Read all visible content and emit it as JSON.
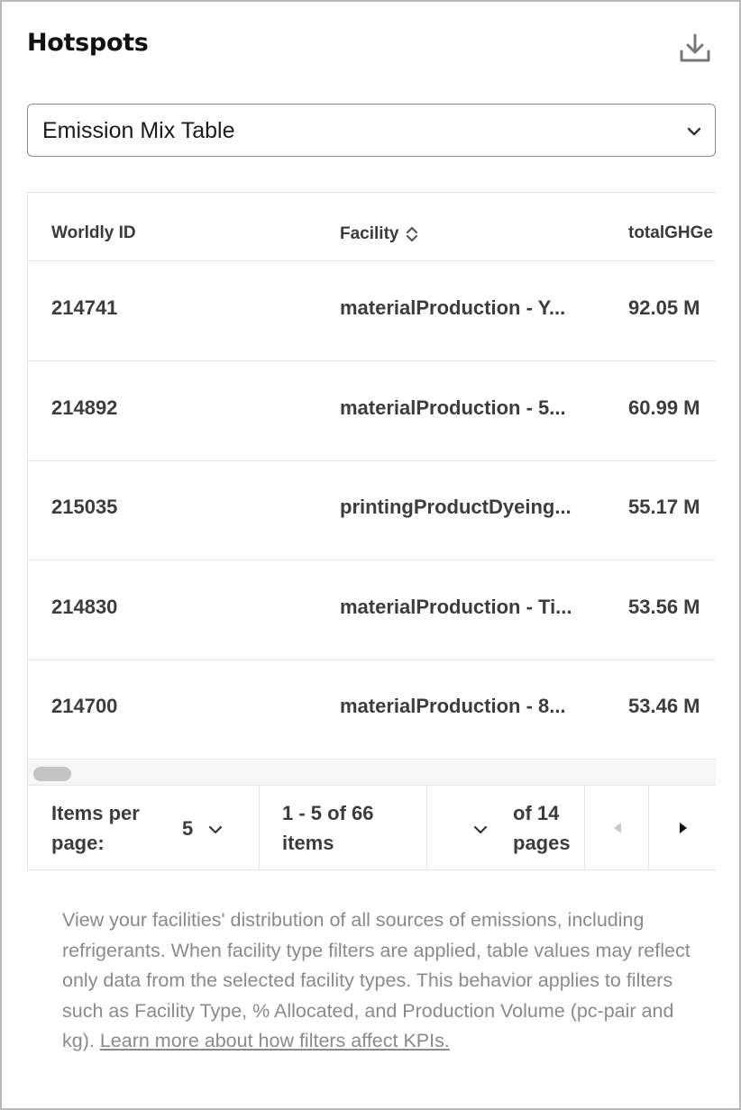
{
  "header": {
    "title": "Hotspots",
    "download_icon": "download-icon"
  },
  "view_select": {
    "selected": "Emission Mix Table"
  },
  "table": {
    "columns": [
      "Worldly ID",
      "Facility",
      "totalGHGe"
    ],
    "rows": [
      {
        "id": "214741",
        "facility": "materialProduction - Y...",
        "total": "92.05 M"
      },
      {
        "id": "214892",
        "facility": "materialProduction - 5...",
        "total": "60.99 M"
      },
      {
        "id": "215035",
        "facility": "printingProductDyeing...",
        "total": "55.17 M"
      },
      {
        "id": "214830",
        "facility": "materialProduction - Ti...",
        "total": "53.56 M"
      },
      {
        "id": "214700",
        "facility": "materialProduction - 8...",
        "total": "53.46 M"
      }
    ]
  },
  "pagination": {
    "items_per_page_label": "Items per page:",
    "items_per_page_value": "5",
    "range_text": "1 - 5 of 66 items",
    "of_pages_text": "of 14 pages"
  },
  "description": {
    "text": "View your facilities' distribution of all sources of emissions, including refrigerants. When facility type filters are applied, table values may reflect only data from the selected facility types. This behavior applies to filters such as Facility Type, % Allocated, and Production Volume (pc-pair and kg). ",
    "link": "Learn more about how filters affect KPIs."
  },
  "colors": {
    "border": "#b9b9b9",
    "text": "#3c3c3c",
    "muted": "#8a8a8a"
  }
}
